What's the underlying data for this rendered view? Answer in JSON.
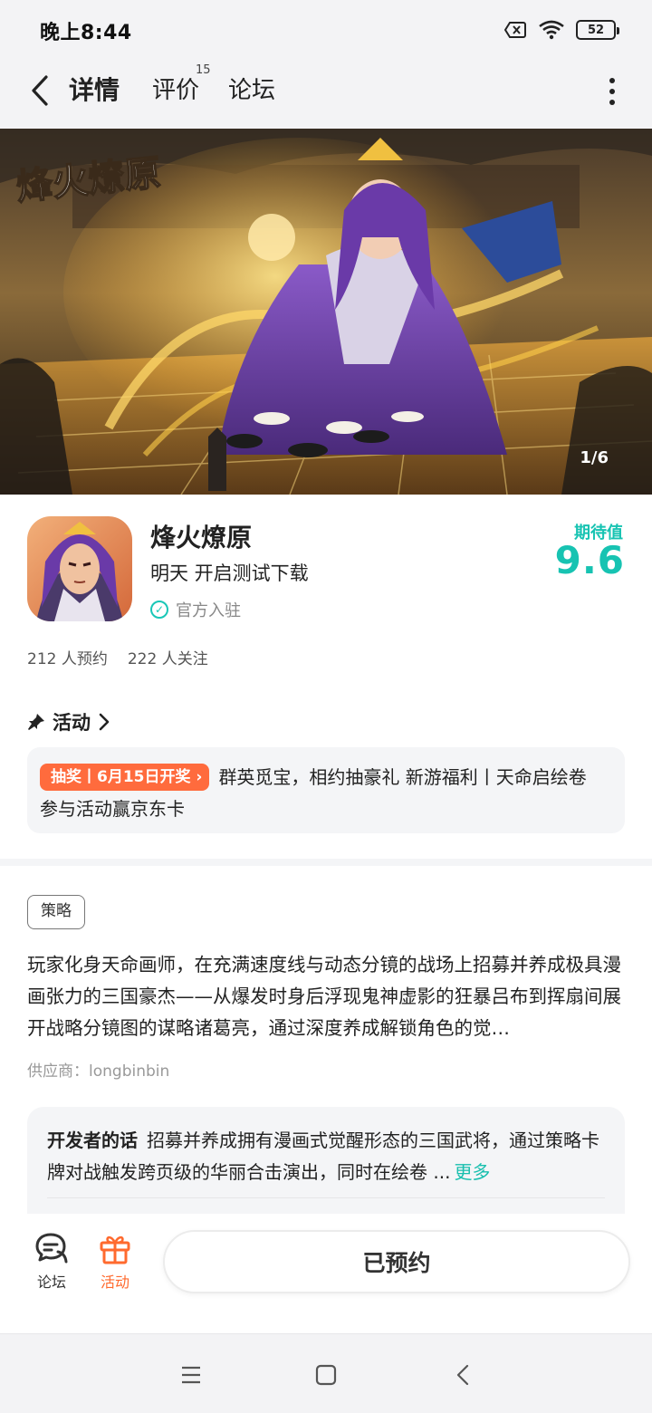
{
  "status_bar": {
    "time": "晚上8:44",
    "battery": "52"
  },
  "nav": {
    "tabs": [
      {
        "label": "详情",
        "active": true
      },
      {
        "label": "评价",
        "badge": "15"
      },
      {
        "label": "论坛"
      }
    ]
  },
  "banner": {
    "counter": "1/6",
    "logo_text": "烽火燎原"
  },
  "game": {
    "title": "烽火燎原",
    "release_status": "明天 开启测试下载",
    "official_label": "官方入驻",
    "expect_label": "期待值",
    "expect_score": "9.6",
    "reservations": "212 人预约",
    "followers": "222 人关注"
  },
  "activity": {
    "header": "活动",
    "tag": "抽奖丨6月15日开奖",
    "text": "群英觅宝，相约抽豪礼 新游福利丨天命启绘卷 参与活动赢京东卡"
  },
  "detail": {
    "genre_tag": "策略",
    "description": "玩家化身天命画师，在充满速度线与动态分镜的战场上招募并养成极具漫画张力的三国豪杰——从爆发时身后浮现鬼神虚影的狂暴吕布到挥扇间展开战略分镜图的谋略诸葛亮，通过深度养成解锁角色的觉…",
    "supplier": "供应商：longbinbin"
  },
  "developer": {
    "label": "开发者的话",
    "text": "招募并养成拥有漫画式觉醒形态的三国武将，通过策略卡牌对战触发跨页级的华丽合击演出，同时在绘卷 ...",
    "more": "更多"
  },
  "action_bar": {
    "forum_label": "论坛",
    "activity_label": "活动",
    "reserve_button": "已预约"
  },
  "colors": {
    "accent": "#17c3b2",
    "activity_orange": "#ff6b3d",
    "background": "#f3f3f5"
  }
}
